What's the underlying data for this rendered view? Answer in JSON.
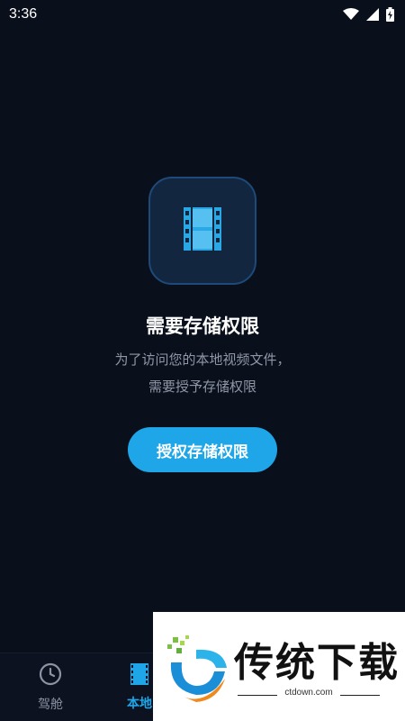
{
  "status_bar": {
    "time": "3:36",
    "icons": [
      "wifi-icon",
      "signal-icon",
      "battery-charging-icon"
    ]
  },
  "permission": {
    "icon": "film-icon",
    "title": "需要存储权限",
    "description_line1": "为了访问您的本地视频文件，",
    "description_line2": "需要授予存储权限",
    "button_label": "授权存储权限"
  },
  "bottom_nav": {
    "items": [
      {
        "label": "驾舱",
        "icon": "clock-icon",
        "active": false
      },
      {
        "label": "本地",
        "icon": "film-icon",
        "active": true
      }
    ]
  },
  "watermark": {
    "text": "传统下载",
    "url": "ctdown.com"
  },
  "colors": {
    "background": "#0a0f1c",
    "accent": "#1ea6e8",
    "tile": "#132640",
    "muted_text": "#8f97a6"
  }
}
